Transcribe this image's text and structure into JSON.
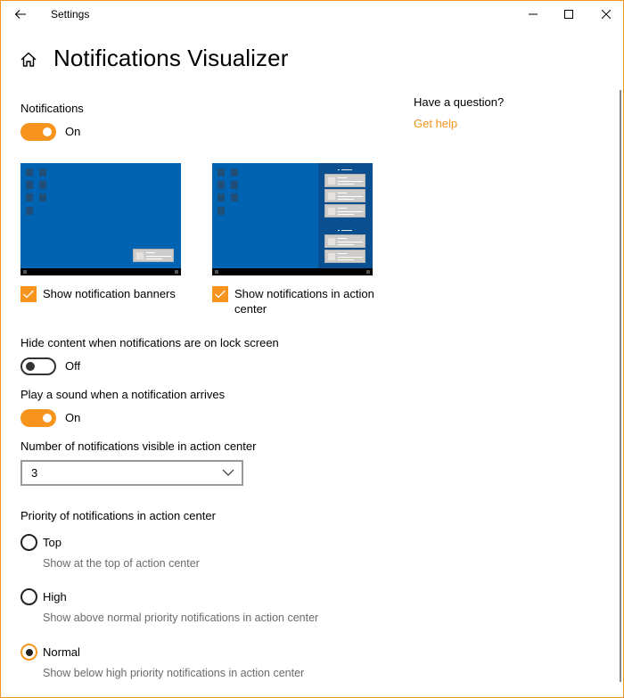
{
  "window": {
    "app_title": "Settings",
    "accent_color": "#f7941d",
    "controls": {
      "minimize": "minimize-icon",
      "maximize": "maximize-icon",
      "close": "close-icon"
    }
  },
  "header": {
    "title": "Notifications Visualizer",
    "back_icon": "back-arrow-icon",
    "home_icon": "home-icon"
  },
  "notifications": {
    "label": "Notifications",
    "state": "On",
    "enabled": true
  },
  "illustrations": [
    {
      "name": "banner-preview",
      "checkbox_label": "Show notification banners",
      "checked": true
    },
    {
      "name": "action-center-preview",
      "checkbox_label": "Show notifications in action center",
      "checked": true
    }
  ],
  "lock_screen": {
    "label": "Hide content when notifications are on lock screen",
    "state": "Off",
    "enabled": false
  },
  "sound": {
    "label": "Play a sound when a notification arrives",
    "state": "On",
    "enabled": true
  },
  "visible_count": {
    "label": "Number of notifications visible in action center",
    "selected": "3"
  },
  "priority": {
    "label": "Priority of notifications in action center",
    "options": [
      {
        "label": "Top",
        "description": "Show at the top of action center",
        "checked": false
      },
      {
        "label": "High",
        "description": "Show above normal priority notifications in action center",
        "checked": false
      },
      {
        "label": "Normal",
        "description": "Show below high priority notifications in action center",
        "checked": true
      }
    ]
  },
  "help": {
    "title": "Have a question?",
    "link": "Get help"
  }
}
